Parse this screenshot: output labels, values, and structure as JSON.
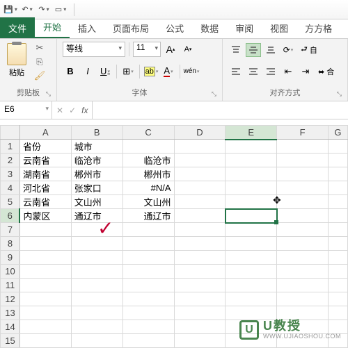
{
  "qat": {
    "save": "💾",
    "undo": "↶",
    "redo": "↷",
    "touch": "▭"
  },
  "tabs": {
    "file": "文件",
    "items": [
      "开始",
      "插入",
      "页面布局",
      "公式",
      "数据",
      "审阅",
      "视图",
      "方方格"
    ],
    "active": 0
  },
  "ribbon": {
    "clipboard": {
      "label": "剪贴板",
      "paste": "粘贴",
      "cut": "✂",
      "copy": "⎘",
      "format_painter": "🖌"
    },
    "font": {
      "label": "字体",
      "name": "等线",
      "size": "11",
      "grow": "A▴",
      "shrink": "A▾",
      "bold": "B",
      "italic": "I",
      "underline": "U",
      "border": "⊞",
      "fill": "A",
      "color": "A",
      "phonetic": "wén"
    },
    "alignment": {
      "label": "对齐方式",
      "wrap": "自",
      "merge": "合"
    }
  },
  "namebox": "E6",
  "fx_label": "fx",
  "columns": [
    "A",
    "B",
    "C",
    "D",
    "E",
    "F",
    "G"
  ],
  "selected_col": "E",
  "selected_row": 6,
  "rows": [
    {
      "n": 1,
      "cells": [
        "省份",
        "城市",
        "",
        "",
        "",
        "",
        ""
      ]
    },
    {
      "n": 2,
      "cells": [
        "云南省",
        "临沧市",
        "临沧市",
        "",
        "",
        "",
        ""
      ]
    },
    {
      "n": 3,
      "cells": [
        "湖南省",
        "郴州市",
        "郴州市",
        "",
        "",
        "",
        ""
      ]
    },
    {
      "n": 4,
      "cells": [
        "河北省",
        "张家口",
        "#N/A",
        "",
        "",
        "",
        ""
      ]
    },
    {
      "n": 5,
      "cells": [
        "云南省",
        "文山州",
        "文山州",
        "",
        "",
        "",
        ""
      ]
    },
    {
      "n": 6,
      "cells": [
        "内蒙区",
        "通辽市",
        "通辽市",
        "",
        "",
        "",
        ""
      ]
    },
    {
      "n": 7,
      "cells": [
        "",
        "",
        "",
        "",
        "",
        "",
        ""
      ]
    },
    {
      "n": 8,
      "cells": [
        "",
        "",
        "",
        "",
        "",
        "",
        ""
      ]
    },
    {
      "n": 9,
      "cells": [
        "",
        "",
        "",
        "",
        "",
        "",
        ""
      ]
    },
    {
      "n": 10,
      "cells": [
        "",
        "",
        "",
        "",
        "",
        "",
        ""
      ]
    },
    {
      "n": 11,
      "cells": [
        "",
        "",
        "",
        "",
        "",
        "",
        ""
      ]
    },
    {
      "n": 12,
      "cells": [
        "",
        "",
        "",
        "",
        "",
        "",
        ""
      ]
    },
    {
      "n": 13,
      "cells": [
        "",
        "",
        "",
        "",
        "",
        "",
        ""
      ]
    },
    {
      "n": 14,
      "cells": [
        "",
        "",
        "",
        "",
        "",
        "",
        ""
      ]
    },
    {
      "n": 15,
      "cells": [
        "",
        "",
        "",
        "",
        "",
        "",
        ""
      ]
    }
  ],
  "checkmark_glyph": "✓",
  "watermark": {
    "badge": "U",
    "line1": "U教授",
    "line2": "WWW.UJIAOSHOU.COM"
  },
  "cursor_glyph": "✥"
}
